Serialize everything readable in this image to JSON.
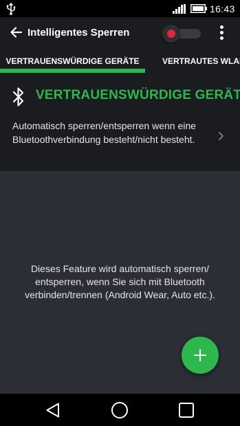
{
  "status_bar": {
    "time": "16:43",
    "icons": [
      "usb-icon",
      "signal-icon",
      "battery-icon"
    ]
  },
  "app_bar": {
    "title": "Intelligentes Sperren",
    "toggle_state": "off",
    "toggle_dot_color": "#e0263a"
  },
  "tabs": [
    {
      "label": "VERTRAUENSWÜRDIGE GERÄTE",
      "active": true
    },
    {
      "label": "VERTRAUTES WLAN",
      "active": false
    }
  ],
  "section": {
    "heading": "VERTRAUENSWÜRDIGE GERÄTE",
    "description": "Automatisch sperren/entsperren wenn eine Bluetoothverbindung besteht/nicht besteht.",
    "icon": "bluetooth-icon"
  },
  "content": {
    "info": "Dieses Feature wird automatisch sperren/ entsperren, wenn Sie sich mit Bluetooth verbinden/trennen (Android Wear, Auto etc.)."
  },
  "fab": {
    "icon": "plus-icon"
  },
  "nav_bar": {
    "icons": [
      "back-triangle-icon",
      "home-circle-icon",
      "recents-square-icon"
    ]
  },
  "colors": {
    "accent": "#2db84d",
    "surface": "#1a1c20",
    "background": "#2b2e35",
    "toggle_dot": "#e0263a"
  }
}
